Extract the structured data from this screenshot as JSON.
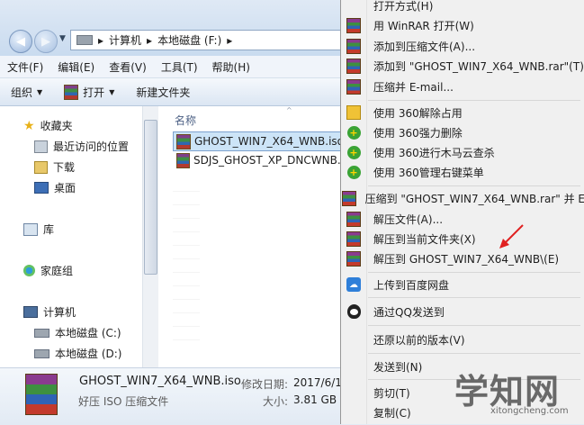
{
  "breadcrumb": {
    "computer": "计算机",
    "drive": "本地磁盘 (F:)"
  },
  "menubar": [
    "文件(F)",
    "编辑(E)",
    "查看(V)",
    "工具(T)",
    "帮助(H)"
  ],
  "toolbar": {
    "organize": "组织",
    "open": "打开",
    "new_folder": "新建文件夹"
  },
  "nav": {
    "favorites": "收藏夹",
    "recent": "最近访问的位置",
    "downloads": "下载",
    "desktop": "桌面",
    "libraries": "库",
    "homegroup": "家庭组",
    "computer": "计算机",
    "drive_c": "本地磁盘 (C:)",
    "drive_d": "本地磁盘 (D:)"
  },
  "files": {
    "column_name": "名称",
    "items": [
      "GHOST_WIN7_X64_WNB.iso",
      "SDJS_GHOST_XP_DNCWNB.i"
    ]
  },
  "details": {
    "filename": "GHOST_WIN7_X64_WNB.iso",
    "modified_label": "修改日期:",
    "modified_value": "2017/6/1",
    "type": "好压 ISO 压缩文件",
    "size_label": "大小:",
    "size_value": "3.81 GB"
  },
  "context_menu": [
    {
      "label": "打开方式(H)",
      "icon": "none"
    },
    {
      "label": "用 WinRAR 打开(W)",
      "icon": "winrar-icon"
    },
    {
      "label": "添加到压缩文件(A)...",
      "icon": "winrar-icon"
    },
    {
      "label": "添加到 \"GHOST_WIN7_X64_WNB.rar\"(T)",
      "icon": "winrar-icon"
    },
    {
      "label": "压缩并 E-mail...",
      "icon": "winrar-icon"
    },
    {
      "label": "使用 360解除占用",
      "icon": "unlock-icon"
    },
    {
      "label": "使用 360强力删除",
      "icon": "360-delete-icon"
    },
    {
      "label": "使用 360进行木马云查杀",
      "icon": "360-scan-icon"
    },
    {
      "label": "使用 360管理右键菜单",
      "icon": "360-scan-icon"
    },
    {
      "label": "压缩到 \"GHOST_WIN7_X64_WNB.rar\" 并 E",
      "icon": "winrar-icon"
    },
    {
      "label": "解压文件(A)...",
      "icon": "winrar-icon"
    },
    {
      "label": "解压到当前文件夹(X)",
      "icon": "winrar-icon"
    },
    {
      "label": "解压到 GHOST_WIN7_X64_WNB\\(E)",
      "icon": "winrar-icon"
    },
    {
      "label": "上传到百度网盘",
      "icon": "baidu-cloud-icon"
    },
    {
      "label": "通过QQ发送到",
      "icon": "qq-icon"
    },
    {
      "label": "还原以前的版本(V)",
      "icon": "none"
    },
    {
      "label": "发送到(N)",
      "icon": "none"
    },
    {
      "label": "剪切(T)",
      "icon": "none"
    },
    {
      "label": "复制(C)",
      "icon": "none"
    }
  ],
  "watermark": {
    "text": "学知网",
    "url": "xitongcheng.com"
  },
  "colors": {
    "arrow": "#e02020",
    "selection": "#cce4f7"
  }
}
